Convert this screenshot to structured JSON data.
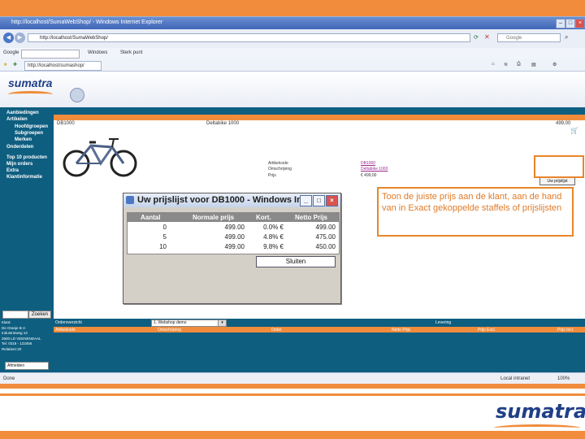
{
  "browser": {
    "title": "http://localhost/SumaWebShop/ - Windows Internet Explorer",
    "address": "http://localhost/SumaWebShop/",
    "search_placeholder": "Google",
    "toolbar_google": "Google",
    "toolbar_windows": "Windows",
    "toolbar_sterkpunt": "Sterk punt",
    "favorite_tab": "http://localhost/sumashop/",
    "status": "Done",
    "status_zone": "Local intranet",
    "status_zoom": "100%"
  },
  "site": {
    "logo": "sumatra",
    "sidebar": {
      "items": [
        "Aanbiedingen",
        "Artikelen",
        "Hoofdgroepen",
        "Subgroepen",
        "Merken",
        "Onderdelen",
        "Top 10 producten",
        "Mijn orders",
        "Extra",
        "Klantinformatie"
      ],
      "search_button": "Zoeken"
    },
    "product": {
      "code": "DB1000",
      "name": "Deltabike 1000",
      "price": "499,00",
      "detail_labels": [
        "Artikelcode",
        "Omschrijving",
        "Prijs"
      ],
      "detail_values": [
        "DB1000",
        "Deltabike 1000",
        "€ 499,00"
      ],
      "price_list_button": "Uw prijslijst"
    },
    "bottom": {
      "order_label": "Orderoverzicht",
      "shop_select": "1. Webshop demo",
      "levering_label": "Levering",
      "columns": [
        "Artikelcode",
        "Omschrijving",
        "Order",
        "Netto Prijs",
        "Prijs Excl.",
        "Prijs Incl."
      ],
      "client_lines": [
        "Klant:",
        "De Oranje B.V.",
        "Industrieweg 13",
        "2500 LD VEENENDAAL",
        "Tel: 0318 - 123456",
        "Relatienr:20"
      ],
      "logout": "Afmelden"
    }
  },
  "popup": {
    "title": "Uw prijslijst voor DB1000 - Windows In...",
    "columns": [
      "Aantal",
      "Normale prijs",
      "Kort.",
      "Netto Prijs"
    ],
    "rows": [
      {
        "aantal": "0",
        "normale": "499.00",
        "kort": "0.0% €",
        "netto": "499.00"
      },
      {
        "aantal": "5",
        "normale": "499.00",
        "kort": "4.8% €",
        "netto": "475.00"
      },
      {
        "aantal": "10",
        "normale": "499.00",
        "kort": "9.8% €",
        "netto": "450.00"
      }
    ],
    "close_button": "Sluiten"
  },
  "annotation": {
    "text": "Toon de juiste prijs aan de klant, aan de hand van in Exact gekoppelde staffels of prijslijsten"
  },
  "slide": {
    "brand": "sumatra"
  },
  "colors": {
    "accent": "#f08c3c",
    "site_blue": "#0e5e80",
    "brand_blue": "#1f3f88"
  }
}
